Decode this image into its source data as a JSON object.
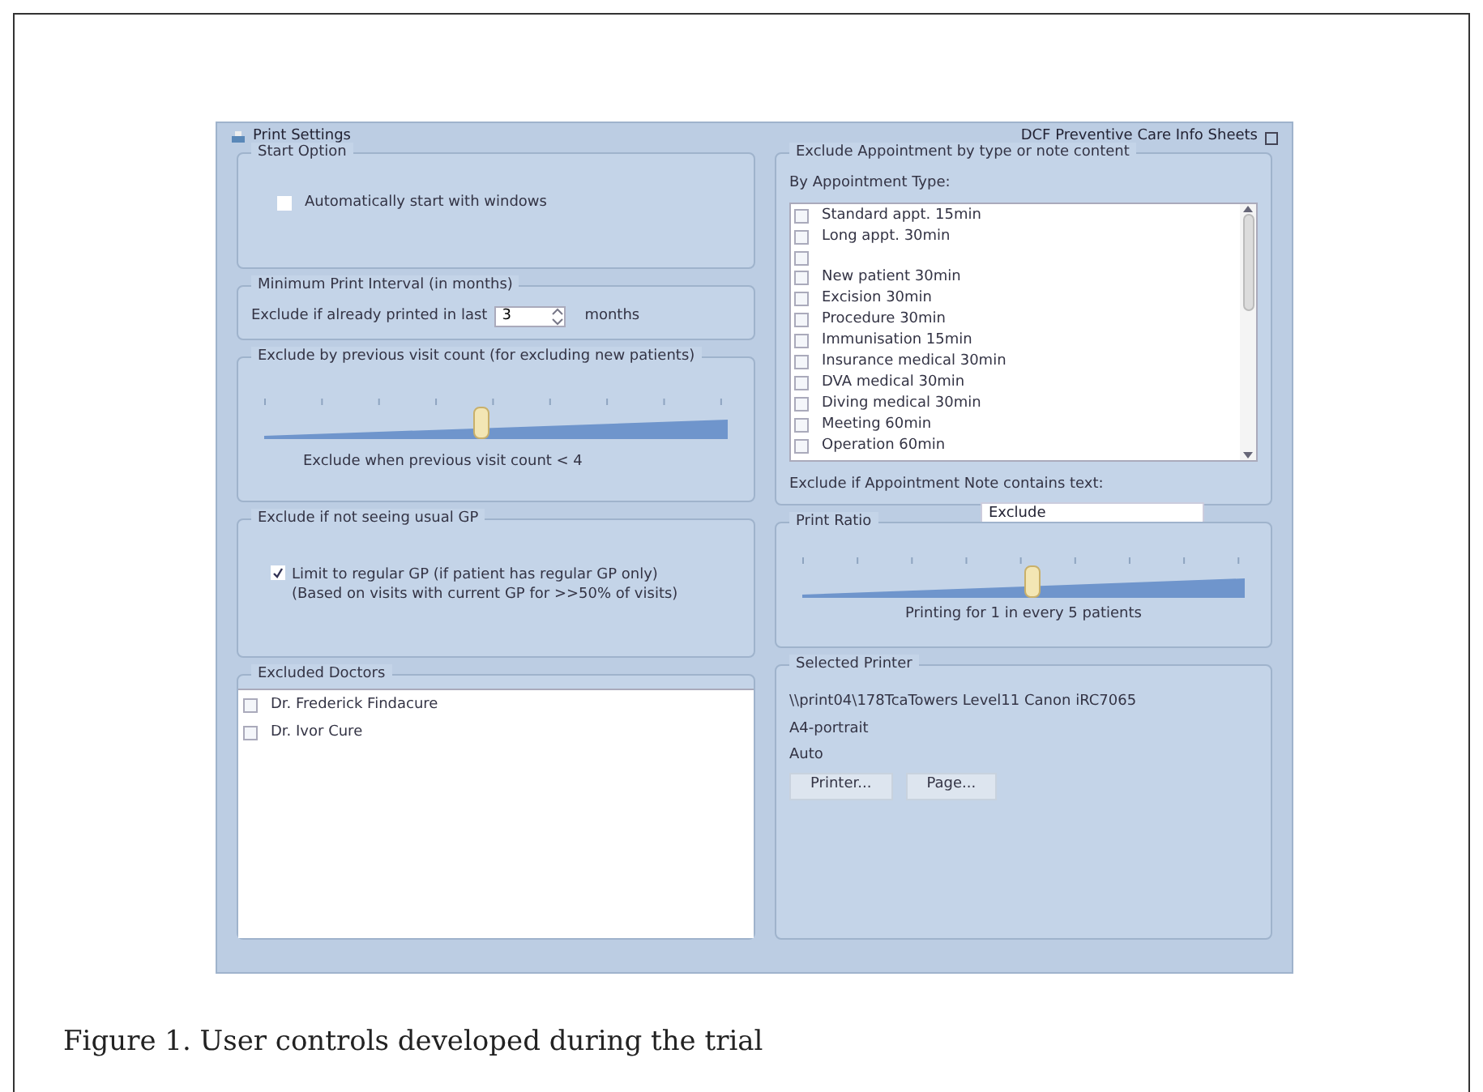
{
  "window": {
    "title": "Print Settings",
    "app_title": "DCF Preventive Care Info Sheets"
  },
  "start_option": {
    "title": "Start Option",
    "checkbox": {
      "label": "Automatically start with windows",
      "checked": false
    }
  },
  "min_interval": {
    "title": "Minimum Print Interval (in months)",
    "label": "Exclude if already printed in last",
    "value": "3",
    "unit": "months"
  },
  "visit_count": {
    "title": "Exclude by previous visit count (for excluding new patients)",
    "slider": {
      "level": 0.47
    },
    "reading": "Exclude when previous visit count < 4"
  },
  "usual_gp": {
    "title": "Exclude if not seeing usual GP",
    "checkbox": {
      "label": "Limit to regular GP (if patient has regular GP only)",
      "note": "(Based on visits with current GP for >>50% of visits)",
      "checked": true
    }
  },
  "excluded_doctors": {
    "title": "Excluded Doctors",
    "items": [
      {
        "label": "Dr. Frederick Findacure",
        "checked": false
      },
      {
        "label": "Dr. Ivor Cure",
        "checked": false
      }
    ]
  },
  "appointment": {
    "title": "Exclude Appointment by type or note content",
    "list_label": "By Appointment Type:",
    "items": [
      {
        "label": "Standard appt. 15min",
        "checked": false
      },
      {
        "label": "Long appt. 30min",
        "checked": false
      },
      {
        "checked": false
      },
      {
        "label": "New patient 30min",
        "checked": false
      },
      {
        "label": "Excision 30min",
        "checked": false
      },
      {
        "label": "Procedure 30min",
        "checked": false
      },
      {
        "label": "Immunisation 15min",
        "checked": false
      },
      {
        "label": "Insurance medical 30min",
        "checked": false
      },
      {
        "label": "DVA medical 30min",
        "checked": false
      },
      {
        "label": "Diving medical 30min",
        "checked": false
      },
      {
        "label": "Meeting 60min",
        "checked": false
      },
      {
        "label": "Operation 60min",
        "checked": false
      }
    ],
    "note_label": "Exclude if Appointment Note contains text:",
    "note_value": "Exclude"
  },
  "print_ratio": {
    "title": "Print Ratio",
    "slider": {
      "level": 0.52
    },
    "reading": "Printing for 1 in every 5 patients"
  },
  "printer": {
    "title": "Selected Printer",
    "lines": [
      "\\\\print04\\178TcaTowers Level11 Canon iRC7065",
      "A4-portrait",
      "Auto"
    ],
    "buttons": [
      "Printer...",
      "Page..."
    ]
  },
  "caption": "Figure 1. User controls developed during the trial"
}
